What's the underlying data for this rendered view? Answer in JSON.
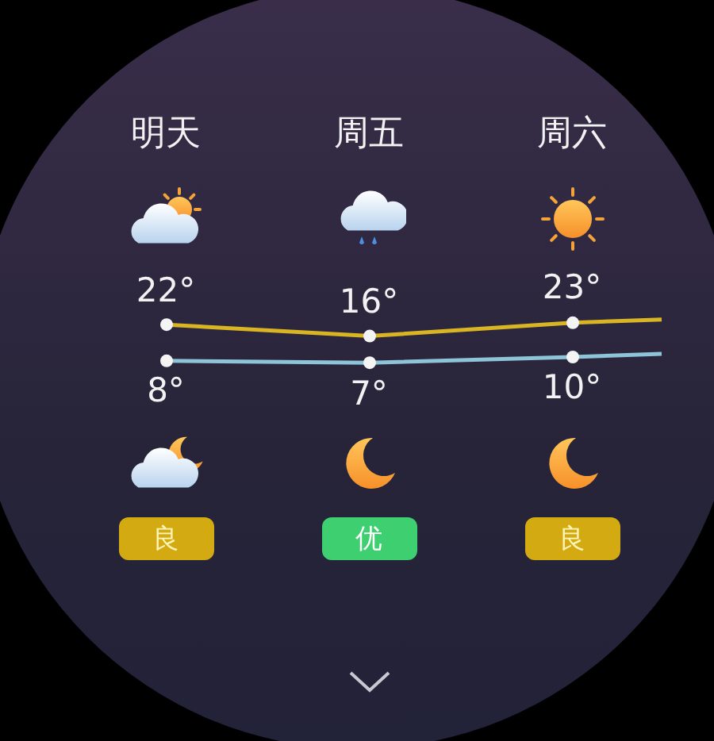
{
  "days": [
    {
      "label": "明天",
      "day_icon": {
        "kind": "partly_cloudy"
      },
      "high": "22°",
      "low": "8°",
      "night_icon": {
        "kind": "cloudy_night"
      },
      "air_quality": {
        "label": "良",
        "color": "#d4aa12"
      }
    },
    {
      "label": "周五",
      "day_icon": {
        "kind": "rain"
      },
      "high": "16°",
      "low": "7°",
      "night_icon": {
        "kind": "moon"
      },
      "air_quality": {
        "label": "优",
        "color": "#3ecf70"
      }
    },
    {
      "label": "周六",
      "day_icon": {
        "kind": "sunny"
      },
      "high": "23°",
      "low": "10°",
      "night_icon": {
        "kind": "moon"
      },
      "air_quality": {
        "label": "良",
        "color": "#d4aa12"
      }
    }
  ]
}
